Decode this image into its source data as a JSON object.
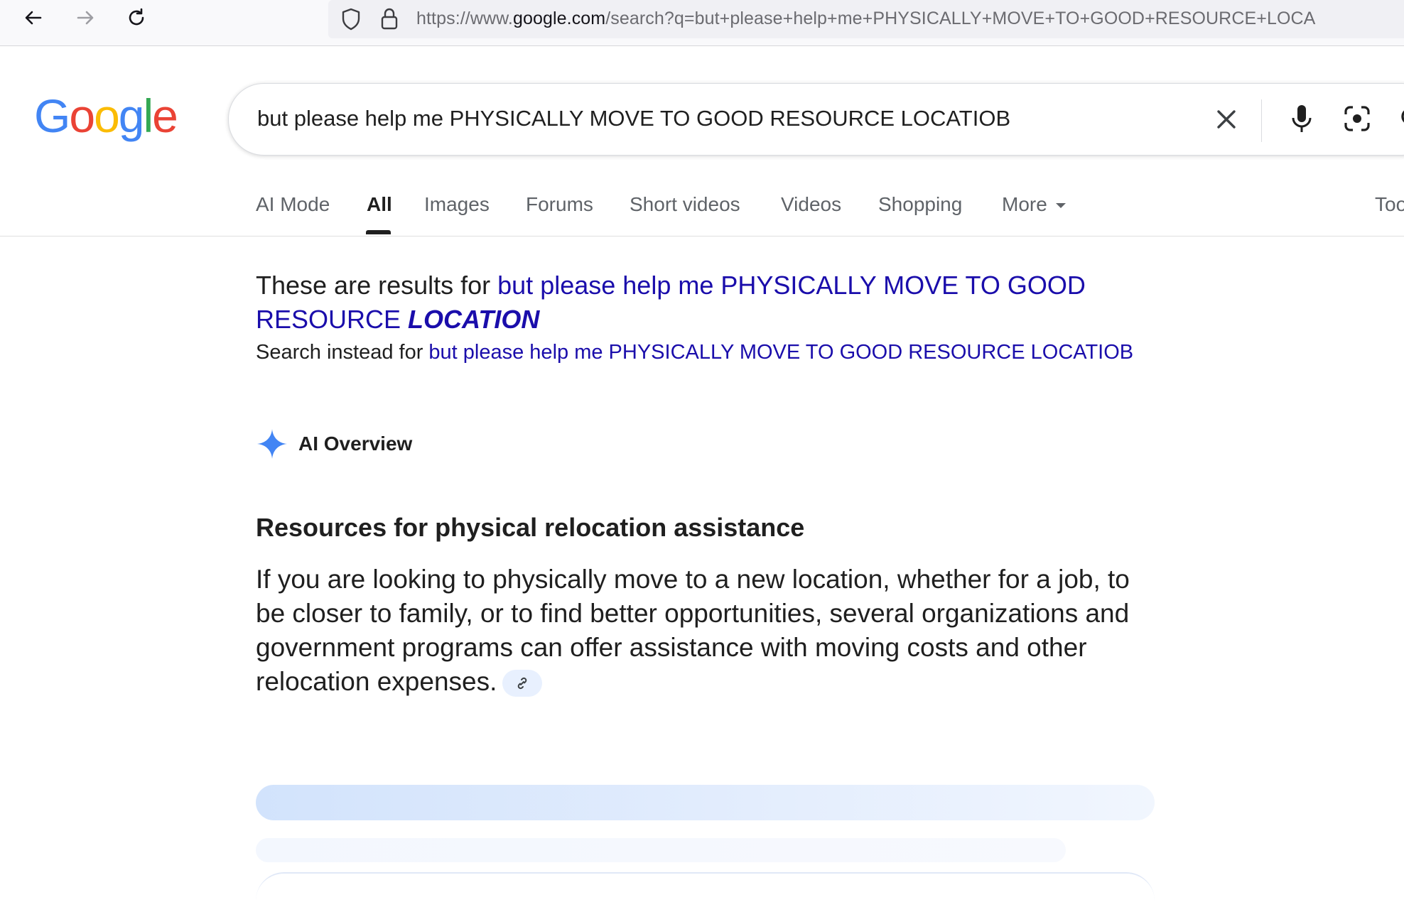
{
  "browser": {
    "url_scheme": "https://www.",
    "url_host": "google.com",
    "url_path": "/search?q=but+please+help+me+PHYSICALLY+MOVE+TO+GOOD+RESOURCE+LOCA"
  },
  "logo": {
    "letters": [
      "G",
      "o",
      "o",
      "g",
      "l",
      "e"
    ],
    "colors": [
      "#4285F4",
      "#EA4335",
      "#FBBC05",
      "#4285F4",
      "#34A853",
      "#EA4335"
    ]
  },
  "search": {
    "query": "but please help me PHYSICALLY MOVE TO GOOD RESOURCE LOCATIOB"
  },
  "tabs": [
    {
      "label": "AI Mode"
    },
    {
      "label": "All"
    },
    {
      "label": "Images"
    },
    {
      "label": "Forums"
    },
    {
      "label": "Short videos"
    },
    {
      "label": "Videos"
    },
    {
      "label": "Shopping"
    },
    {
      "label": "More"
    },
    {
      "label": "Too"
    }
  ],
  "correction": {
    "prefix": "These are results for ",
    "corrected_main": "but please help me PHYSICALLY MOVE TO GOOD RESOURCE ",
    "corrected_emphasis": "LOCATION",
    "instead_prefix": "Search instead for ",
    "original_query": "but please help me PHYSICALLY MOVE TO GOOD RESOURCE LOCATIOB"
  },
  "ai_overview": {
    "label": "AI Overview",
    "heading": "Resources for physical relocation assistance",
    "body": "If you are looking to physically move to a new location, whether for a job, to be closer to family, or to find better opportunities, several organizations and government programs can offer assistance with moving costs and other relocation expenses."
  },
  "colors": {
    "link": "#1a0dab",
    "text": "#1f1f1f",
    "muted": "#5f6368",
    "ai_sparkle": "#4285F4"
  }
}
